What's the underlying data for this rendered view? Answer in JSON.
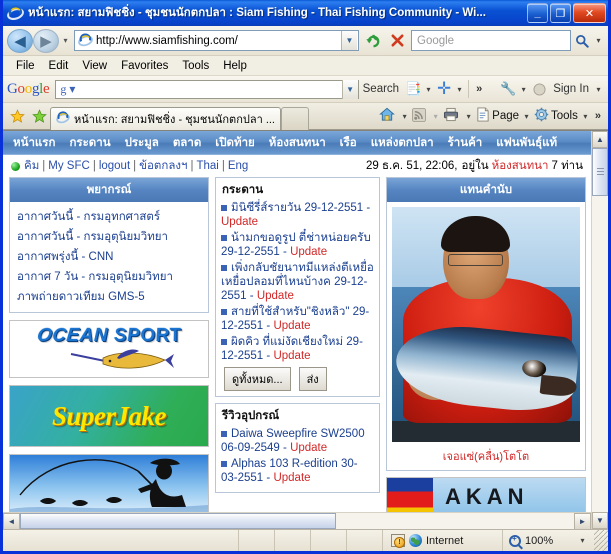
{
  "window": {
    "title": "หน้าแรก: สยามฟิชชิ่ง - ชุมชนนักตกปลา : Siam Fishing - Thai Fishing Community - Wi...",
    "minimize_label": "_",
    "maximize_label": "❐",
    "close_label": "✕"
  },
  "address_bar": {
    "back_icon": "back-arrow-icon",
    "forward_icon": "forward-arrow-icon",
    "url": "http://www.siamfishing.com/",
    "refresh_icon": "refresh-icon",
    "stop_icon": "stop-icon",
    "search_placeholder": "Google",
    "search_value": "",
    "go_icon": "search-icon"
  },
  "menu": {
    "items": [
      "File",
      "Edit",
      "View",
      "Favorites",
      "Tools",
      "Help"
    ]
  },
  "google_toolbar": {
    "logo": "Google",
    "search_value": "",
    "search_label": "Search",
    "overflow_label": "»",
    "signin_label": "Sign In"
  },
  "tab_bar": {
    "tab_title": "หน้าแรก: สยามฟิชชิ่ง - ชุมชนนักตกปลา ...",
    "home_label": "Home",
    "page_label": "Page",
    "tools_label": "Tools",
    "overflow_label": "»"
  },
  "site": {
    "nav": [
      "หน้าแรก",
      "กระดาน",
      "ประมูล",
      "ตลาด",
      "เปิดท้าย",
      "ห้องสนทนา",
      "เรือ",
      "แหล่งตกปลา",
      "ร้านค้า",
      "แฟนพันธุ์แท้"
    ],
    "status_left": {
      "user": "คิม",
      "links": [
        "My SFC",
        "logout",
        "ข้อตกลงฯ",
        "Thai",
        "Eng"
      ]
    },
    "status_right": {
      "date": "29 ธ.ค. 51, 22:06,",
      "prefix": "อยู่ใน",
      "room": "ห้องสนทนา",
      "suffix": "7 ท่าน"
    },
    "left_column": {
      "weather_panel": {
        "title": "พยากรณ์",
        "items": [
          "อากาศวันนี้ - กรมอุทกศาสตร์",
          "อากาศวันนี้ - กรมอุตุนิยมวิทยา",
          "อากาศพรุ่งนี้ - CNN",
          "อากาศ 7 วัน - กรมอุตุนิยมวิทยา",
          "ภาพถ่ายดาวเทียม GMS-5"
        ]
      },
      "banners": [
        {
          "name": "OCEAN SPORT",
          "text": "OCEAN SPORT"
        },
        {
          "name": "Super Jake",
          "text": "SuperJake"
        },
        {
          "name": "fisherman-banner",
          "text": ""
        }
      ]
    },
    "mid_column": {
      "board_panel": {
        "title": "กระดาน",
        "items": [
          {
            "text": "มินิซีรี่ส์รายวัน",
            "date": "29-12-2551",
            "update": "Update"
          },
          {
            "text": "น้ามกขอดูรูป ตี๋ช่าหน่อยครับ",
            "date": "29-12-2551",
            "update": "Update"
          },
          {
            "text": "เพิ่งกลับชัยนาทมีแหล่งตีเหยื่อเหยื่อปลอมที่ไหนบ้างค",
            "date": "29-12-2551",
            "update": "Update"
          },
          {
            "text": "สายที่ใช้สำหรับ\"ชิงหลิว\"",
            "date": "29-12-2551",
            "update": "Update"
          },
          {
            "text": "ผิดคิว ที่แม่งัดเชียงใหม่",
            "date": "29-12-2551",
            "update": "Update"
          }
        ],
        "buttons": [
          "ดูทั้งหมด...",
          "ส่ง"
        ]
      },
      "review_panel": {
        "title": "รีวิวอุปกรณ์",
        "items": [
          {
            "text": "Daiwa Sweepfire SW2500",
            "date": "06-09-2549",
            "update": "Update"
          },
          {
            "text": "Alphas 103 R-edition",
            "date": "30-03-2551",
            "update": "Update"
          }
        ]
      }
    },
    "right_column": {
      "photo_panel": {
        "title": "แทนคำนับ",
        "caption": "เจอแซ่(คลื่น)โตโต"
      },
      "banner": {
        "name": "akan-banner",
        "text": "AKAN"
      }
    }
  },
  "scrollbars": {
    "up_arrow": "▲",
    "down_arrow": "▼",
    "left_arrow": "◄",
    "right_arrow": "►"
  },
  "statusbar": {
    "message": "",
    "zone": "Internet",
    "zoom": "100%",
    "zoom_dropdown": "▾"
  }
}
